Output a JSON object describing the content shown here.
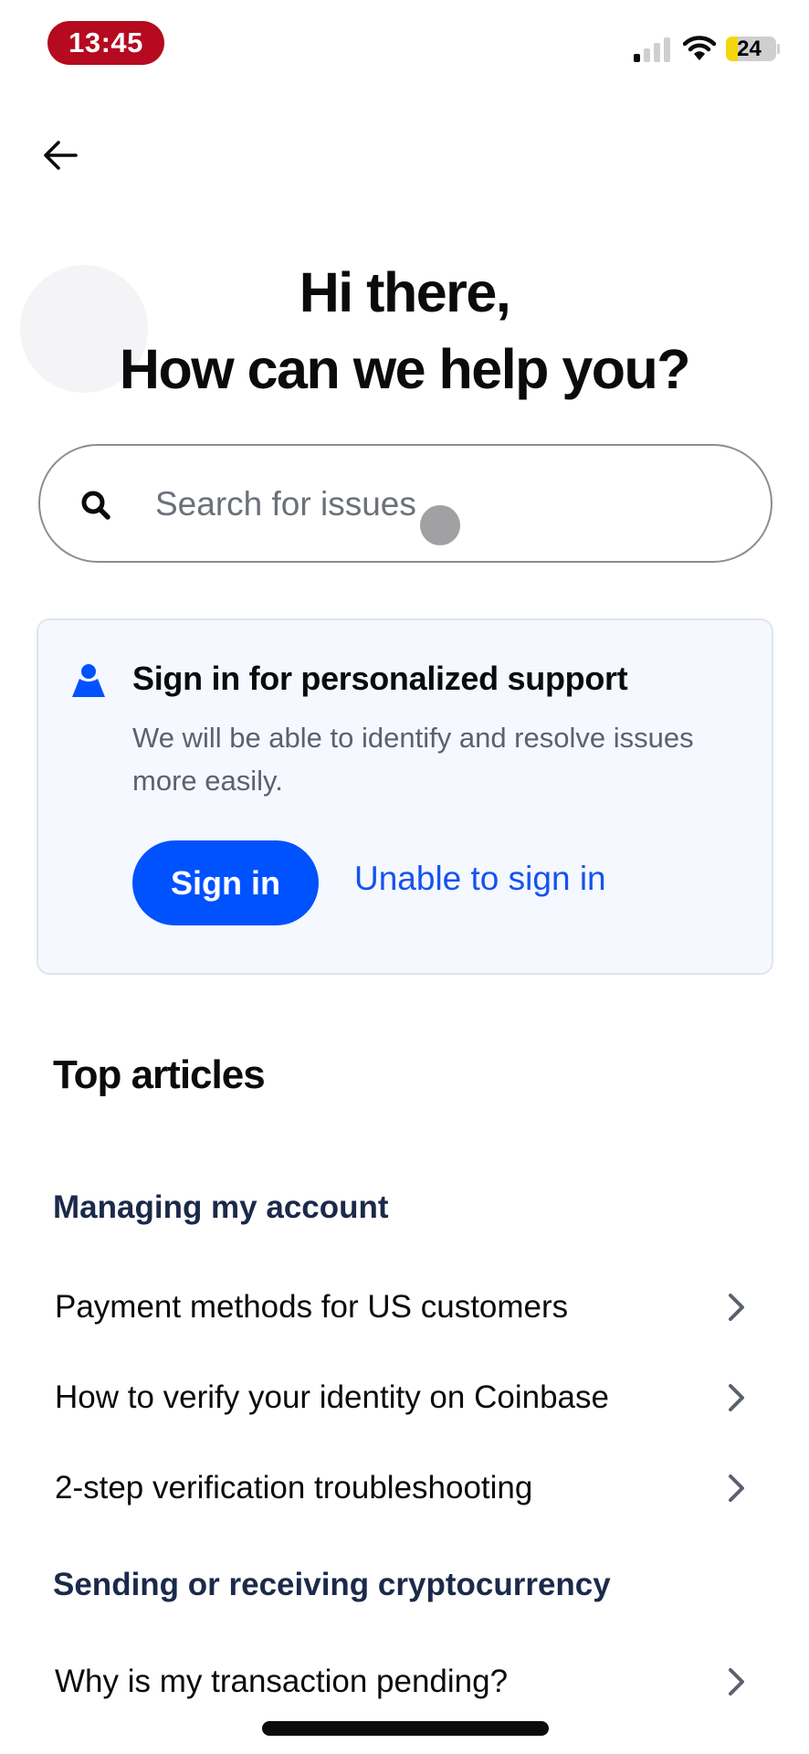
{
  "status_bar": {
    "time": "13:45",
    "time_pill_color": "#b50a1f",
    "signal_bars_active": 1,
    "signal_bars_total": 4,
    "wifi_icon": "wifi-icon",
    "battery_percent": 24,
    "battery_label": "24",
    "battery_mode_color": "#f5d60a"
  },
  "nav": {
    "back_icon": "arrow-left-icon"
  },
  "header": {
    "line1": "Hi there,",
    "line2": "How can we help you?"
  },
  "search": {
    "icon": "search-icon",
    "placeholder": "Search for issues",
    "value": ""
  },
  "signin_card": {
    "icon": "person-icon",
    "title": "Sign in for personalized support",
    "description": "We will be able to identify and resolve issues more easily.",
    "primary_button": "Sign in",
    "secondary_link": "Unable to sign in",
    "accent_color": "#0052ff"
  },
  "top_articles": {
    "title": "Top articles",
    "categories": [
      {
        "title": "Managing my account",
        "articles": [
          {
            "label": "Payment methods for US customers"
          },
          {
            "label": "How to verify your identity on Coinbase"
          },
          {
            "label": "2-step verification troubleshooting"
          }
        ]
      },
      {
        "title": "Sending or receiving cryptocurrency",
        "articles": [
          {
            "label": "Why is my transaction pending?"
          }
        ]
      }
    ]
  }
}
